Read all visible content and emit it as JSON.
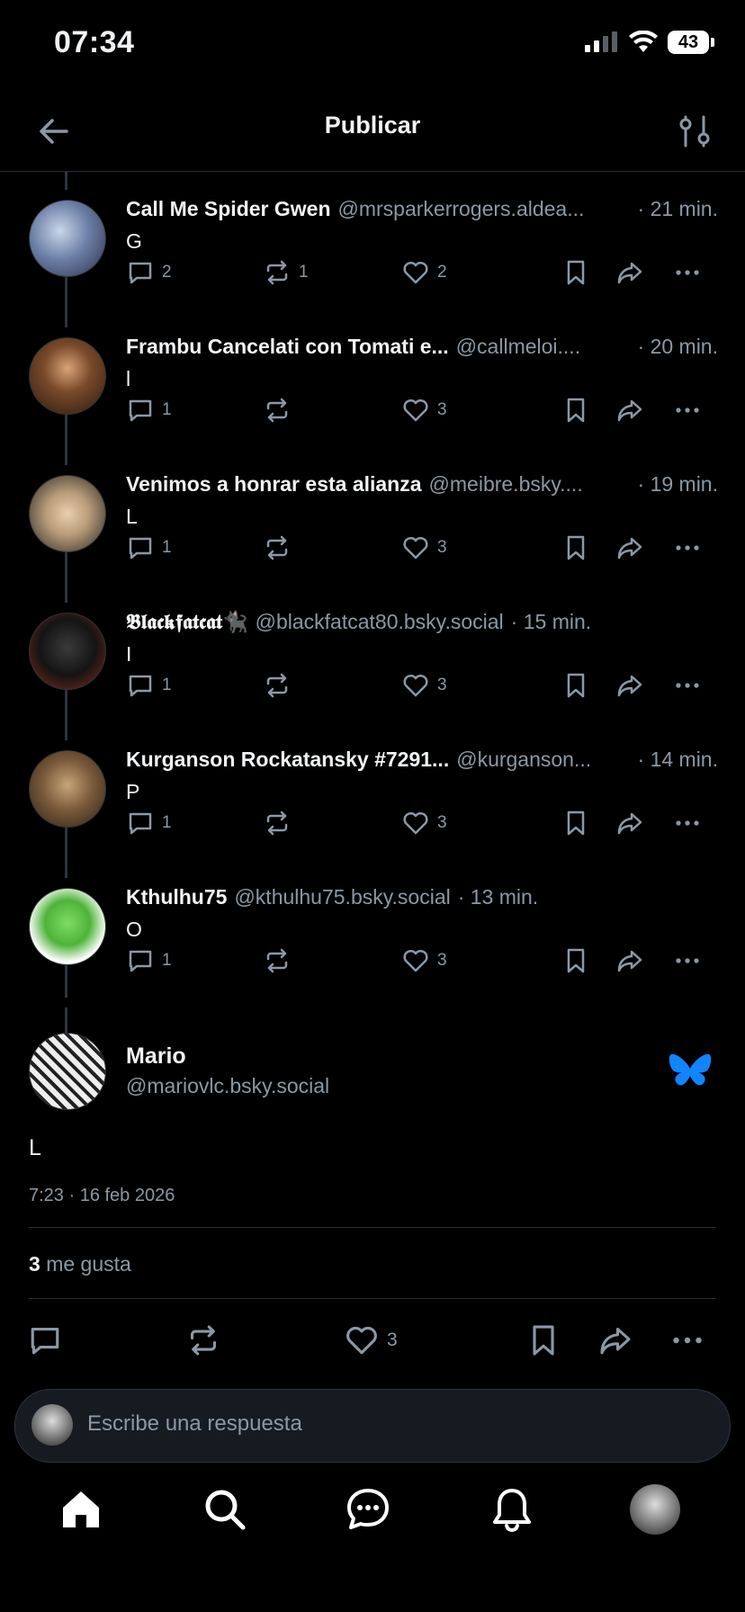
{
  "status": {
    "time": "07:34",
    "battery": "43"
  },
  "nav": {
    "title": "Publicar"
  },
  "thread": [
    {
      "name": "Call Me Spider Gwen",
      "handle": "@mrsparkerrogers.aldea...",
      "time": "· 21 min.",
      "text": "G",
      "replies": "2",
      "reposts": "1",
      "likes": "2"
    },
    {
      "name": "Frambu Cancelati con Tomati e...",
      "handle": "@callmeloi....",
      "time": "· 20 min.",
      "text": "l",
      "replies": "1",
      "reposts": "",
      "likes": "3"
    },
    {
      "name": "Venimos a honrar esta alianza",
      "handle": "@meibre.bsky....",
      "time": "· 19 min.",
      "text": "L",
      "replies": "1",
      "reposts": "",
      "likes": "3"
    },
    {
      "name": "𝕭𝖑𝖆𝖈𝖐𝖋𝖆𝖙𝖈𝖆𝖙🐈‍⬛",
      "handle": "@blackfatcat80.bsky.social",
      "time": "· 15 min.",
      "text": "I",
      "replies": "1",
      "reposts": "",
      "likes": "3"
    },
    {
      "name": "Kurganson Rockatansky #7291...",
      "handle": "@kurganson...",
      "time": "· 14 min.",
      "text": "P",
      "replies": "1",
      "reposts": "",
      "likes": "3"
    },
    {
      "name": "Kthulhu75",
      "handle": "@kthulhu75.bsky.social",
      "time": "· 13 min.",
      "text": "O",
      "replies": "1",
      "reposts": "",
      "likes": "3"
    }
  ],
  "main": {
    "name": "Mario",
    "handle": "@mariovlc.bsky.social",
    "text": "L",
    "timestamp": "7:23 · 16 feb 2026",
    "likes_count": "3",
    "likes_label": "me gusta",
    "like_action_count": "3"
  },
  "reply": {
    "placeholder": "Escribe una respuesta"
  },
  "colors": {
    "accent": "#1185fe",
    "muted": "#8b98a5",
    "background": "#000000"
  }
}
